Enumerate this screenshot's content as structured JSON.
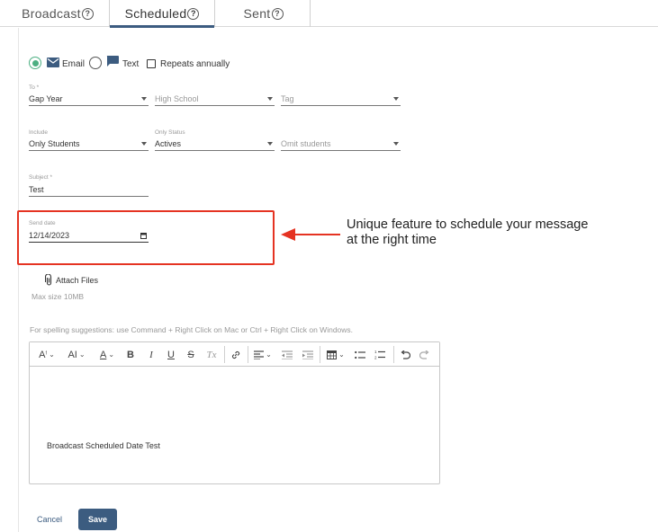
{
  "tabs": [
    {
      "label": "Broadcast",
      "help": "?"
    },
    {
      "label": "Scheduled",
      "help": "?"
    },
    {
      "label": "Sent",
      "help": "?"
    }
  ],
  "channel": {
    "email_label": "Email",
    "text_label": "Text",
    "repeats_label": "Repeats annually",
    "selected": "email"
  },
  "to": {
    "label": "To *",
    "group": "Gap Year",
    "school_placeholder": "High School",
    "tag_placeholder": "Tag"
  },
  "include": {
    "label": "Include",
    "value": "Only Students",
    "status_label": "Only Status",
    "status_value": "Actives",
    "omit_placeholder": "Omit students"
  },
  "subject": {
    "label": "Subject *",
    "value": "Test"
  },
  "send_date": {
    "label": "Send date",
    "value": "12/14/2023"
  },
  "annotation": {
    "line1": "Unique feature to schedule your message",
    "line2": "at the right time",
    "color": "#e53322"
  },
  "attach": {
    "label": "Attach Files",
    "max_size": "Max size 10MB"
  },
  "spell_hint": "For spelling suggestions: use Command + Right Click on Mac or Ctrl + Right Click on Windows.",
  "toolbar": {
    "font_size": "A",
    "font_family": "AI",
    "font_color": "A",
    "bold": "B",
    "italic": "I",
    "underline": "U",
    "strike": "S",
    "clear": "Tx"
  },
  "editor": {
    "body": "Broadcast Scheduled Date Test"
  },
  "actions": {
    "cancel": "Cancel",
    "save": "Save",
    "accent": "#3c5c80"
  }
}
